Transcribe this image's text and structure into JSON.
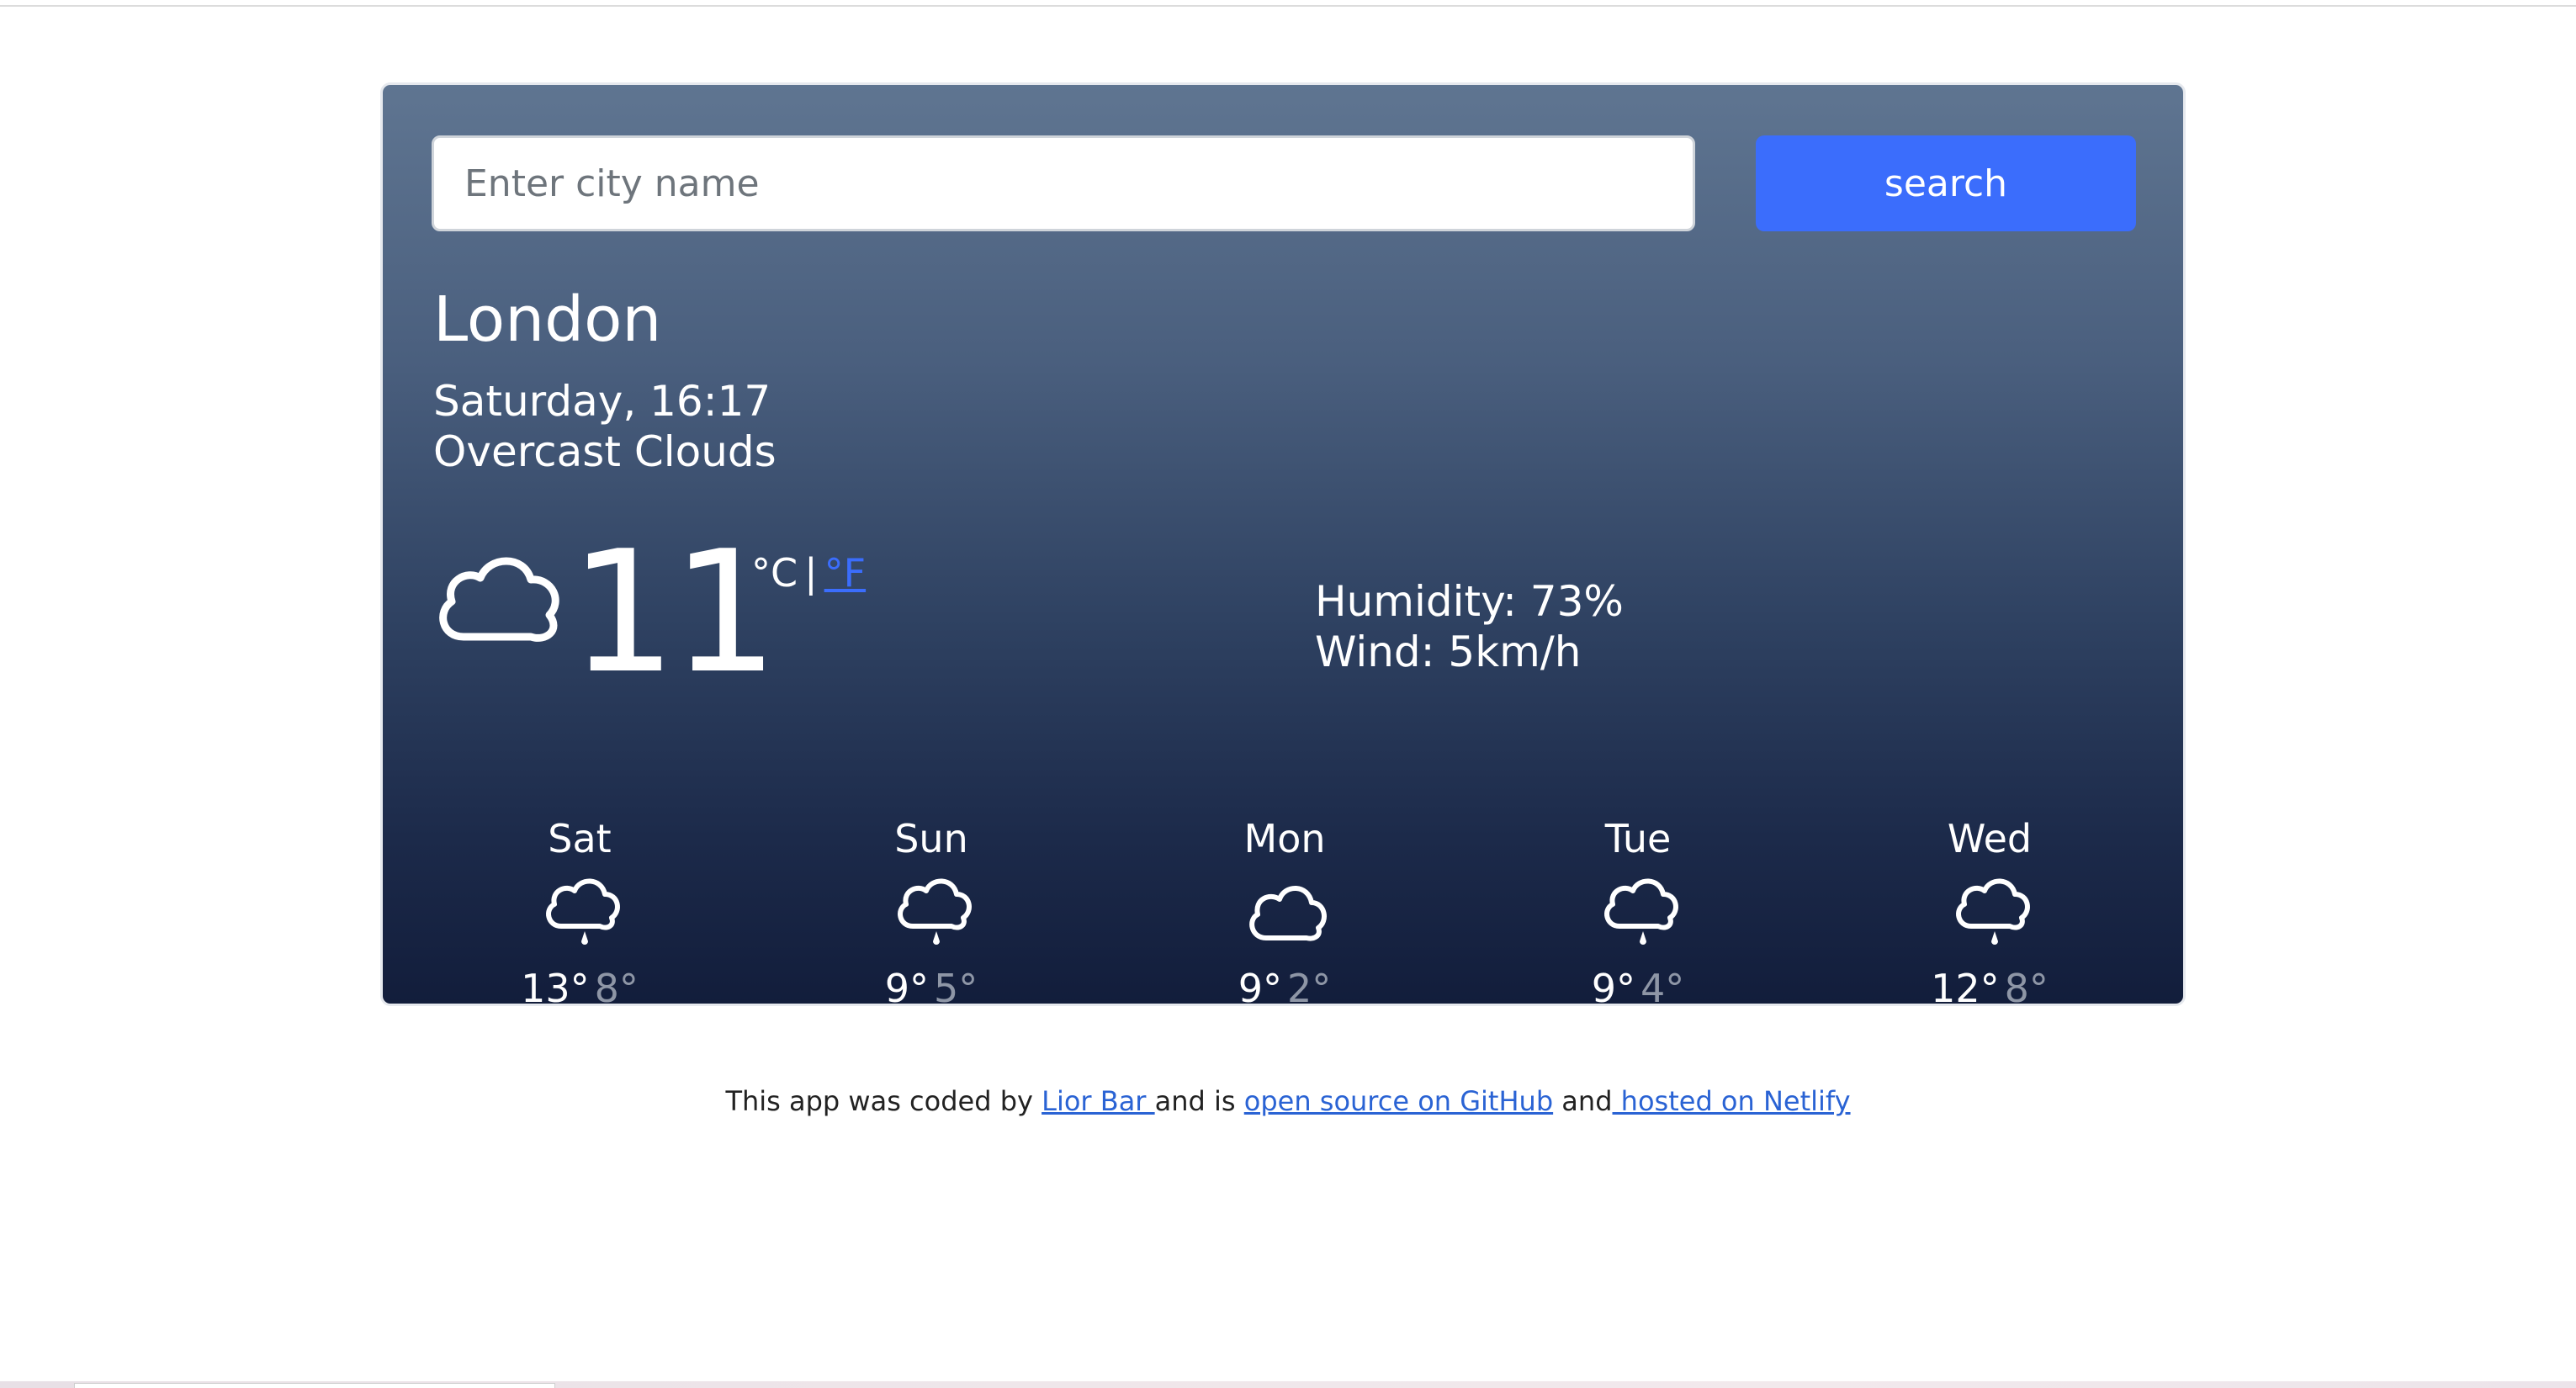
{
  "search": {
    "placeholder": "Enter city name",
    "value": "",
    "button_label": "search"
  },
  "current": {
    "city": "London",
    "datetime": "Saturday, 16:17",
    "description": "Overcast Clouds",
    "icon": "cloud-icon",
    "temperature": "11",
    "unit_celsius": "°C",
    "unit_separator": "|",
    "unit_fahrenheit": "°F",
    "humidity": "Humidity: 73%",
    "wind": "Wind: 5km/h"
  },
  "forecast": [
    {
      "day": "Sat",
      "icon": "rain-cloud-icon",
      "max": "13°",
      "min": "8°"
    },
    {
      "day": "Sun",
      "icon": "rain-cloud-icon",
      "max": "9°",
      "min": "5°"
    },
    {
      "day": "Mon",
      "icon": "cloud-icon",
      "max": "9°",
      "min": "2°"
    },
    {
      "day": "Tue",
      "icon": "rain-cloud-icon",
      "max": "9°",
      "min": "4°"
    },
    {
      "day": "Wed",
      "icon": "rain-cloud-icon",
      "max": "12°",
      "min": "8°"
    }
  ],
  "footer": {
    "prefix": "This app was coded by ",
    "author_link": "Lior Bar ",
    "middle": "and is ",
    "github_link": "open source on GitHub",
    "and": " and",
    "netlify_link": " hosted on Netlify"
  },
  "colors": {
    "accent": "#3b6dfc",
    "card_top": "#5f7591",
    "card_bottom": "#121d3b",
    "link": "#2a63d4",
    "min_temp": "#8e96a6"
  }
}
